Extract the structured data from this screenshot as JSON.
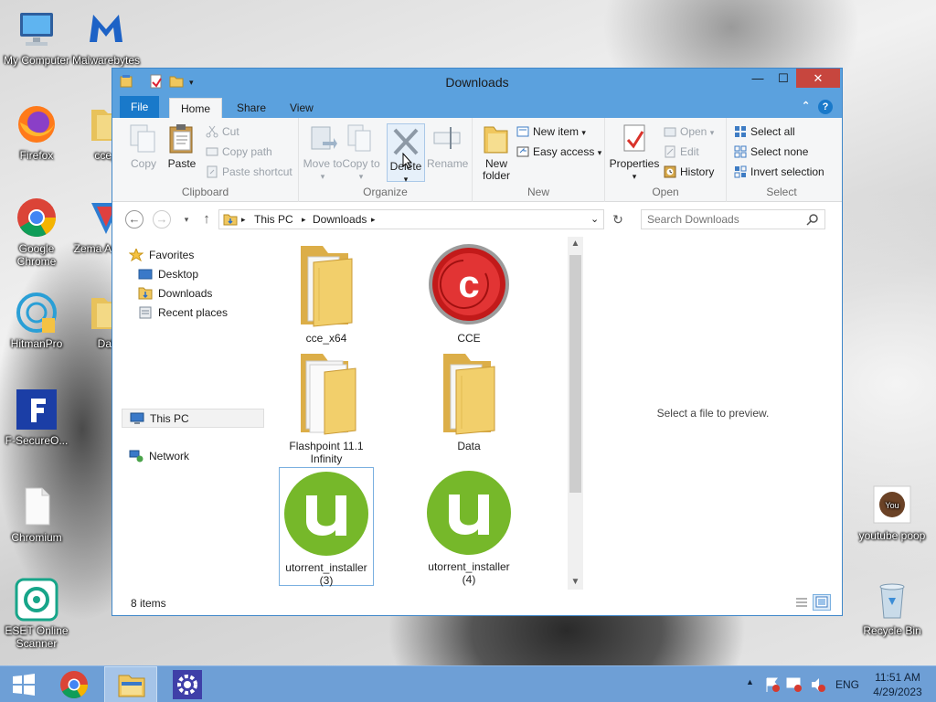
{
  "desktop": {
    "icons": [
      {
        "label": "My Computer",
        "icon": "computer-icon"
      },
      {
        "label": "Malwarebytes",
        "icon": "malwarebytes-icon"
      },
      {
        "label": "Firefox",
        "icon": "firefox-icon"
      },
      {
        "label": "cce_",
        "icon": "folder-icon"
      },
      {
        "label": "Google Chrome",
        "icon": "chrome-icon"
      },
      {
        "label": "Zema AntiMa",
        "icon": "zemana-icon"
      },
      {
        "label": "HitmanPro",
        "icon": "hitmanpro-icon"
      },
      {
        "label": "Dat",
        "icon": "folder-icon"
      },
      {
        "label": "F-SecureO...",
        "icon": "fsecure-icon"
      },
      {
        "label": "Chromium",
        "icon": "file-icon"
      },
      {
        "label": "ESET Online Scanner",
        "icon": "eset-icon"
      },
      {
        "label": "youtube poop",
        "icon": "youtube-icon"
      },
      {
        "label": "Recycle Bin",
        "icon": "recycle-bin-icon"
      }
    ]
  },
  "window": {
    "title": "Downloads",
    "controls": {
      "minimize": "—",
      "maximize": "☐",
      "close": "✕",
      "help": "?"
    },
    "tabs": [
      "File",
      "Home",
      "Share",
      "View"
    ],
    "ribbon": {
      "clipboard": {
        "label": "Clipboard",
        "copy": "Copy",
        "paste": "Paste",
        "cut": "Cut",
        "copy_path": "Copy path",
        "paste_shortcut": "Paste shortcut"
      },
      "organize": {
        "label": "Organize",
        "move_to": "Move to",
        "copy_to": "Copy to",
        "delete": "Delete",
        "rename": "Rename"
      },
      "new": {
        "label": "New",
        "new_folder": "New folder",
        "new_item": "New item",
        "easy_access": "Easy access"
      },
      "open": {
        "label": "Open",
        "properties": "Properties",
        "open": "Open",
        "edit": "Edit",
        "history": "History"
      },
      "select": {
        "label": "Select",
        "select_all": "Select all",
        "select_none": "Select none",
        "invert_selection": "Invert selection"
      }
    },
    "address": {
      "segments": [
        "This PC",
        "Downloads"
      ],
      "search_placeholder": "Search Downloads"
    },
    "nav": {
      "favorites": "Favorites",
      "desktop": "Desktop",
      "downloads": "Downloads",
      "recent": "Recent places",
      "this_pc": "This PC",
      "network": "Network"
    },
    "files": [
      {
        "name": "cce_x64",
        "icon": "folder-icon"
      },
      {
        "name": "CCE",
        "icon": "comodo-icon"
      },
      {
        "name": "Flashpoint 11.1 Infinity",
        "icon": "folder-icon"
      },
      {
        "name": "Data",
        "icon": "folder-icon"
      },
      {
        "name": "utorrent_installer (3)",
        "icon": "utorrent-icon"
      },
      {
        "name": "utorrent_installer (4)",
        "icon": "utorrent-icon"
      }
    ],
    "preview_message": "Select a file to preview.",
    "status": "8 items"
  },
  "taskbar": {
    "language": "ENG",
    "time": "11:51 AM",
    "date": "4/29/2023"
  },
  "colors": {
    "titlebar": "#5ba1de",
    "file_tab": "#1979ca",
    "taskbar": "#6e9fd6",
    "utorrent": "#76b82a"
  }
}
